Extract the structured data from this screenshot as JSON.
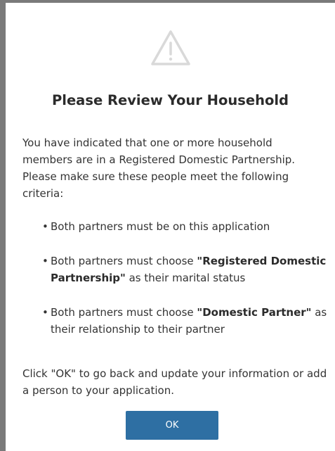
{
  "dialog": {
    "icon": "warning-triangle-icon",
    "title": "Please Review Your Household",
    "intro": "You have indicated that one or more household members are in a Registered Domestic Partnership. Please make sure these people meet the following criteria:",
    "criteria": [
      {
        "text_before": "Both partners must be on this application",
        "bold": "",
        "text_after": ""
      },
      {
        "text_before": "Both partners must choose ",
        "bold": "\"Registered Domestic Partnership\"",
        "text_after": " as their marital status"
      },
      {
        "text_before": "Both partners must choose ",
        "bold": "\"Domestic Partner\"",
        "text_after": " as their relationship to their partner"
      }
    ],
    "closing": "Click \"OK\" to go back and update your information or add a person to your application.",
    "ok_label": "OK"
  },
  "colors": {
    "button_bg": "#2e6fa3",
    "overlay": "#7a7a7a",
    "icon_stroke": "#d9d9d9"
  }
}
